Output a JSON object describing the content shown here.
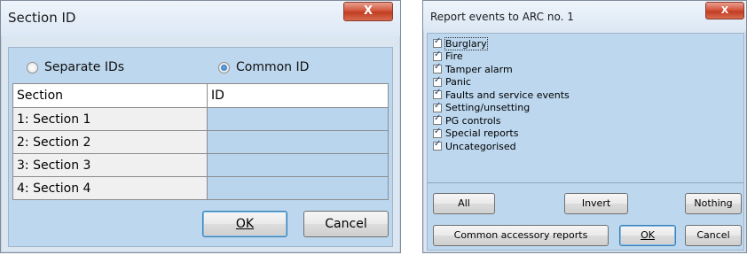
{
  "dialog1": {
    "title": "Section ID",
    "close_label": "X",
    "radio_separate": "Separate IDs",
    "radio_common": "Common ID",
    "radio_selected": "common",
    "columns": [
      "Section",
      "ID"
    ],
    "rows": [
      {
        "section": "1: Section 1",
        "id": ""
      },
      {
        "section": "2: Section 2",
        "id": ""
      },
      {
        "section": "3: Section 3",
        "id": ""
      },
      {
        "section": "4: Section 4",
        "id": ""
      }
    ],
    "ok_label": "OK",
    "cancel_label": "Cancel"
  },
  "dialog2": {
    "title": "Report events to ARC no. 1",
    "close_label": "X",
    "events": [
      {
        "label": "Burglary",
        "checked": true
      },
      {
        "label": "Fire",
        "checked": true
      },
      {
        "label": "Tamper alarm",
        "checked": true
      },
      {
        "label": "Panic",
        "checked": true
      },
      {
        "label": "Faults and service events",
        "checked": true
      },
      {
        "label": "Setting/unsetting",
        "checked": true
      },
      {
        "label": "PG controls",
        "checked": true
      },
      {
        "label": "Special reports",
        "checked": true
      },
      {
        "label": "Uncategorised",
        "checked": true
      }
    ],
    "all_label": "All",
    "invert_label": "Invert",
    "nothing_label": "Nothing",
    "common_label": "Common accessory reports",
    "ok_label": "OK",
    "cancel_label": "Cancel"
  },
  "colors": {
    "client_bg": "#bcd7ee",
    "title_bg": "#dce8f5",
    "close_red": "#c13d22"
  }
}
